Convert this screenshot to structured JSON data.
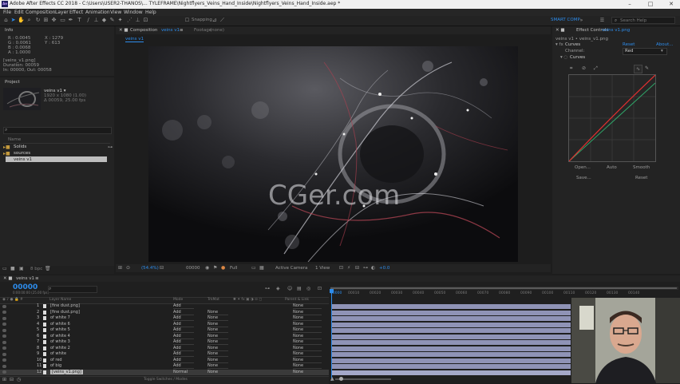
{
  "titlebar": {
    "title": "Adobe After Effects CC 2018 - C:\\Users\\USER2-THANOS\\... TYLEFRAME\\Nightflyers_Veins_Hand_Inside\\Nightflyers_Veins_Hand_Inside.aep *",
    "minimize": "–",
    "maximize": "□",
    "close": "✕"
  },
  "menus": [
    "File",
    "Edit",
    "Composition",
    "Layer",
    "Effect",
    "Animation",
    "View",
    "Window",
    "Help"
  ],
  "toolbar": {
    "snapping": "Snapping",
    "workspace": "STANDARD",
    "workspace_active": "SMART COMP",
    "search_placeholder": "Search Help"
  },
  "info": {
    "tab": "Info",
    "r": "R : 0.0045",
    "g": "G : 0.0061",
    "b": "B : 0.0068",
    "a": "A : 1.0000",
    "x": "X : 1279",
    "y": "Y : 613",
    "file": "[veins_v1.png]",
    "duration": "Duration: 00059",
    "inout": "In: 00000, Out: 00058"
  },
  "project": {
    "tab": "Project",
    "item_name": "veins v1 ▾",
    "item_size": "1920 x 1080 (1.00)",
    "item_duration": "Δ 00059, 25.00 fps",
    "col_name": "Name",
    "folders": [
      "Solids",
      "sources"
    ],
    "selected": "veins v1",
    "bpc": "8 bpc"
  },
  "composition": {
    "tab": "Composition",
    "tab_name": "veins v1",
    "footage_tab": "Footage",
    "footage_value": "(none)",
    "subtab": "veins v1",
    "watermark": "CGer.com",
    "zoom": "(54.4%)",
    "timecode": "00000",
    "resolution": "Full",
    "camera": "Active Camera",
    "view": "1 View",
    "exposure": "+0.0"
  },
  "effects": {
    "tab": "Effect Controls",
    "tab_layer": "veins v1.png",
    "header": "veins v1 • veins_v1.png",
    "effect": "Curves",
    "reset": "Reset",
    "about": "About...",
    "channel_label": "Channel:",
    "channel_value": "Red",
    "curves_label": "Curves",
    "btn_open": "Open...",
    "btn_auto": "Auto",
    "btn_smooth": "Smooth",
    "btn_save": "Save...",
    "btn_reset": "Reset"
  },
  "timeline": {
    "tab": "veins v1",
    "timecode": "00000",
    "subtime": "0:00:00:00 (25.00 fps)",
    "col_layer": "Layer Name",
    "col_mode": "Mode",
    "col_trk": "TrkMat",
    "col_parent": "Parent & Link",
    "ruler": [
      "00010",
      "00020",
      "00030",
      "00040",
      "00050",
      "00060",
      "00070",
      "00080",
      "00090",
      "00100",
      "00110",
      "00120",
      "00130",
      "00140"
    ],
    "ruler_start": "00000",
    "layers": [
      {
        "num": "1",
        "name": "[fine dust.png]",
        "mode": "Add",
        "trk": "",
        "parent": "None"
      },
      {
        "num": "2",
        "name": "[fine dust.png]",
        "mode": "Add",
        "trk": "None",
        "parent": "None"
      },
      {
        "num": "3",
        "name": "of white 7",
        "mode": "Add",
        "trk": "None",
        "parent": "None"
      },
      {
        "num": "4",
        "name": "of white 6",
        "mode": "Add",
        "trk": "None",
        "parent": "None"
      },
      {
        "num": "5",
        "name": "of white 5",
        "mode": "Add",
        "trk": "None",
        "parent": "None"
      },
      {
        "num": "6",
        "name": "of white 4",
        "mode": "Add",
        "trk": "None",
        "parent": "None"
      },
      {
        "num": "7",
        "name": "of white 3",
        "mode": "Add",
        "trk": "None",
        "parent": "None"
      },
      {
        "num": "8",
        "name": "of white 2",
        "mode": "Add",
        "trk": "None",
        "parent": "None"
      },
      {
        "num": "9",
        "name": "of white",
        "mode": "Add",
        "trk": "None",
        "parent": "None"
      },
      {
        "num": "10",
        "name": "of red",
        "mode": "Add",
        "trk": "None",
        "parent": "None"
      },
      {
        "num": "11",
        "name": "of big",
        "mode": "Add",
        "trk": "None",
        "parent": "None"
      },
      {
        "num": "12",
        "name": "[veins_v1.png]",
        "mode": "Normal",
        "trk": "None",
        "parent": "None"
      }
    ],
    "footer": "Toggle Switches / Modes"
  },
  "colors": {
    "accent": "#2d8ceb",
    "layer_bar": "#8f93b6",
    "curve_red": "#e03030",
    "curve_green": "#2fa86a"
  }
}
